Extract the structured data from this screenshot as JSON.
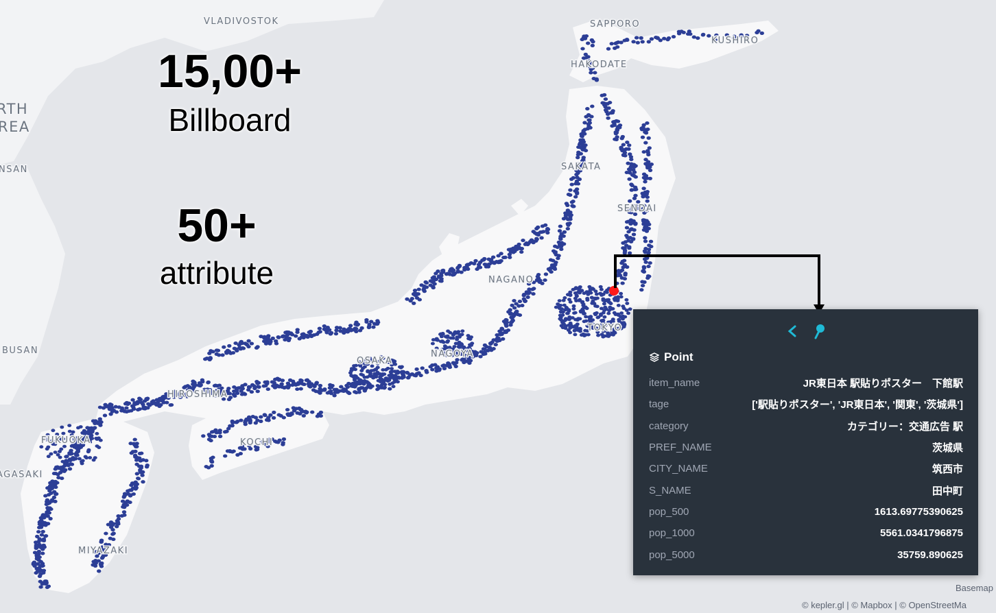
{
  "headline": {
    "count": "15,00+",
    "count_label": "Billboard",
    "attrs": "50+",
    "attrs_label": "attribute"
  },
  "map_labels": [
    "VLADIVOSTOK",
    "SAPPORO",
    "KUSHIRO",
    "HAKODATE",
    "RTH",
    "REA",
    "NSAN",
    "SAKATA",
    "SENDAI",
    "NAGANO",
    "TOKYO",
    "OSAKA",
    "NAGOYA",
    "HIROSHIMA",
    "FUKUOKA",
    "KOCHI",
    "AGASAKI",
    "MIYAZAKI",
    "BUSAN"
  ],
  "tooltip": {
    "layer_title": "Point",
    "rows": [
      {
        "key": "item_name",
        "value": "JR東日本 駅貼りポスター　下館駅"
      },
      {
        "key": "tage",
        "value": "['駅貼りポスター', 'JR東日本', '関東', '茨城県']"
      },
      {
        "key": "category",
        "value": "カテゴリー：交通広告 駅"
      },
      {
        "key": "PREF_NAME",
        "value": "茨城県"
      },
      {
        "key": "CITY_NAME",
        "value": "筑西市"
      },
      {
        "key": "S_NAME",
        "value": "田中町"
      },
      {
        "key": "pop_500",
        "value": "1613.69775390625"
      },
      {
        "key": "pop_1000",
        "value": "5561.0341796875"
      },
      {
        "key": "pop_5000",
        "value": "35759.890625"
      }
    ]
  },
  "attribution": "© kepler.gl | © Mapbox | © OpenStreetMa",
  "basemap_label": "Basemap",
  "colors": {
    "point": "#2c3e96",
    "selected": "#ff1a1a",
    "tooltip_bg": "#29323c",
    "accent": "#1fbad6"
  },
  "icons": [
    "chevron-left-icon",
    "pin-icon",
    "layers-icon"
  ]
}
